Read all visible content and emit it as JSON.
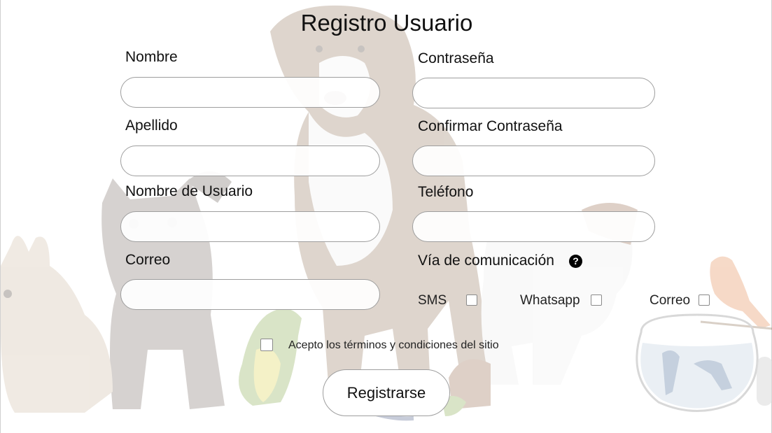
{
  "form": {
    "title": "Registro Usuario",
    "left_fields": [
      {
        "label": "Nombre",
        "value": "",
        "placeholder": ""
      },
      {
        "label": "Apellido",
        "value": "",
        "placeholder": ""
      },
      {
        "label": "Nombre de Usuario",
        "value": "",
        "placeholder": ""
      },
      {
        "label": "Correo",
        "value": "",
        "placeholder": ""
      }
    ],
    "right_fields": [
      {
        "label": "Contraseña",
        "value": "",
        "placeholder": ""
      },
      {
        "label": "Confirmar Contraseña",
        "value": "",
        "placeholder": ""
      },
      {
        "label": "Teléfono",
        "value": "",
        "placeholder": ""
      }
    ],
    "communication": {
      "label": "Vía de comunicación",
      "help_icon": "question-circle-icon",
      "help_glyph": "?",
      "options": [
        {
          "label": "SMS",
          "checked": false
        },
        {
          "label": "Whatsapp",
          "checked": false
        },
        {
          "label": "Correo",
          "checked": false
        }
      ]
    },
    "terms": {
      "label": "Acepto los términos y condiciones del sitio",
      "checked": false
    },
    "submit_label": "Registrarse"
  },
  "background": {
    "description_icons": [
      "rabbit",
      "kitten",
      "dog",
      "parrot",
      "puppy",
      "canary",
      "fishbowl"
    ]
  }
}
